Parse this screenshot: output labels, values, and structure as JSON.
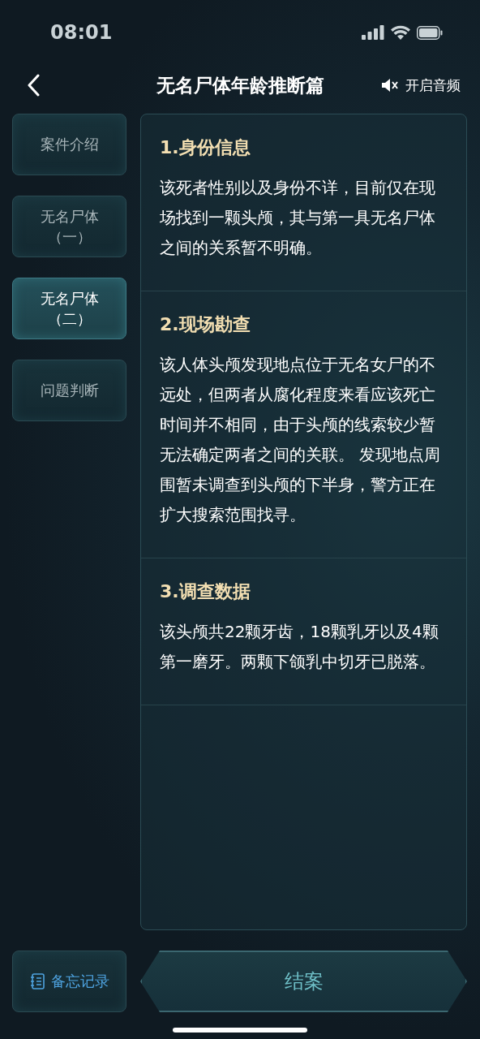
{
  "status_bar": {
    "time": "08:01"
  },
  "header": {
    "title": "无名尸体年龄推断篇",
    "audio_label": "开启音频",
    "audio_muted": true
  },
  "sidebar": {
    "items": [
      {
        "label": "案件介绍",
        "selected": false
      },
      {
        "label": "无名尸体（一）",
        "selected": false
      },
      {
        "label": "无名尸体（二）",
        "selected": true
      },
      {
        "label": "问题判断",
        "selected": false
      }
    ]
  },
  "sections": [
    {
      "heading": "1.身份信息",
      "body": "该死者性别以及身份不详，目前仅在现场找到一颗头颅，其与第一具无名尸体之间的关系暂不明确。"
    },
    {
      "heading": "2.现场勘查",
      "body": "该人体头颅发现地点位于无名女尸的不远处，但两者从腐化程度来看应该死亡时间并不相同，由于头颅的线索较少暂无法确定两者之间的关联。 发现地点周围暂未调查到头颅的下半身，警方正在扩大搜索范围找寻。"
    },
    {
      "heading": "3.调查数据",
      "body": "该头颅共22颗牙齿，18颗乳牙以及4颗第一磨牙。两颗下颌乳中切牙已脱落。"
    }
  ],
  "footer": {
    "memo_label": "备忘记录",
    "close_label": "结案"
  }
}
